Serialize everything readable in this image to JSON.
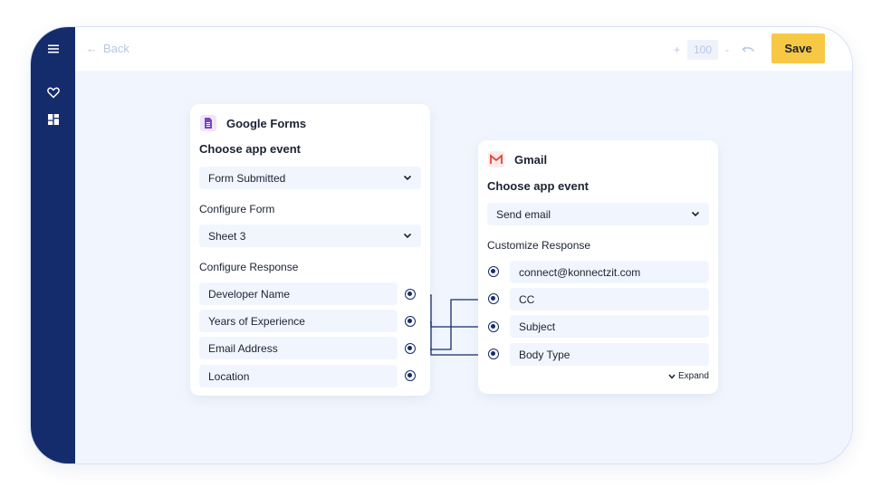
{
  "topbar": {
    "back_label": "Back",
    "zoom_plus": "+",
    "zoom_value": "100",
    "zoom_minus": "-",
    "save_label": "Save"
  },
  "sidebar": {
    "icons": [
      "menu-icon",
      "heart-icon",
      "dashboard-icon"
    ]
  },
  "trigger_card": {
    "app_name": "Google Forms",
    "choose_event_label": "Choose app event",
    "event_value": "Form Submitted",
    "configure_form_label": "Configure Form",
    "form_value": "Sheet 3",
    "configure_response_label": "Configure Response",
    "fields": [
      "Developer Name",
      "Years of Experience",
      "Email Address",
      "Location"
    ]
  },
  "action_card": {
    "app_name": "Gmail",
    "choose_event_label": "Choose app event",
    "event_value": "Send email",
    "customize_response_label": "Customize Response",
    "fields": [
      "connect@konnectzit.com",
      "CC",
      "Subject",
      "Body Type"
    ],
    "expand_label": "Expand"
  },
  "colors": {
    "sidebar": "#142c6c",
    "save_button": "#f7c843",
    "canvas": "#f1f6fe",
    "connector": "#142c6c"
  }
}
